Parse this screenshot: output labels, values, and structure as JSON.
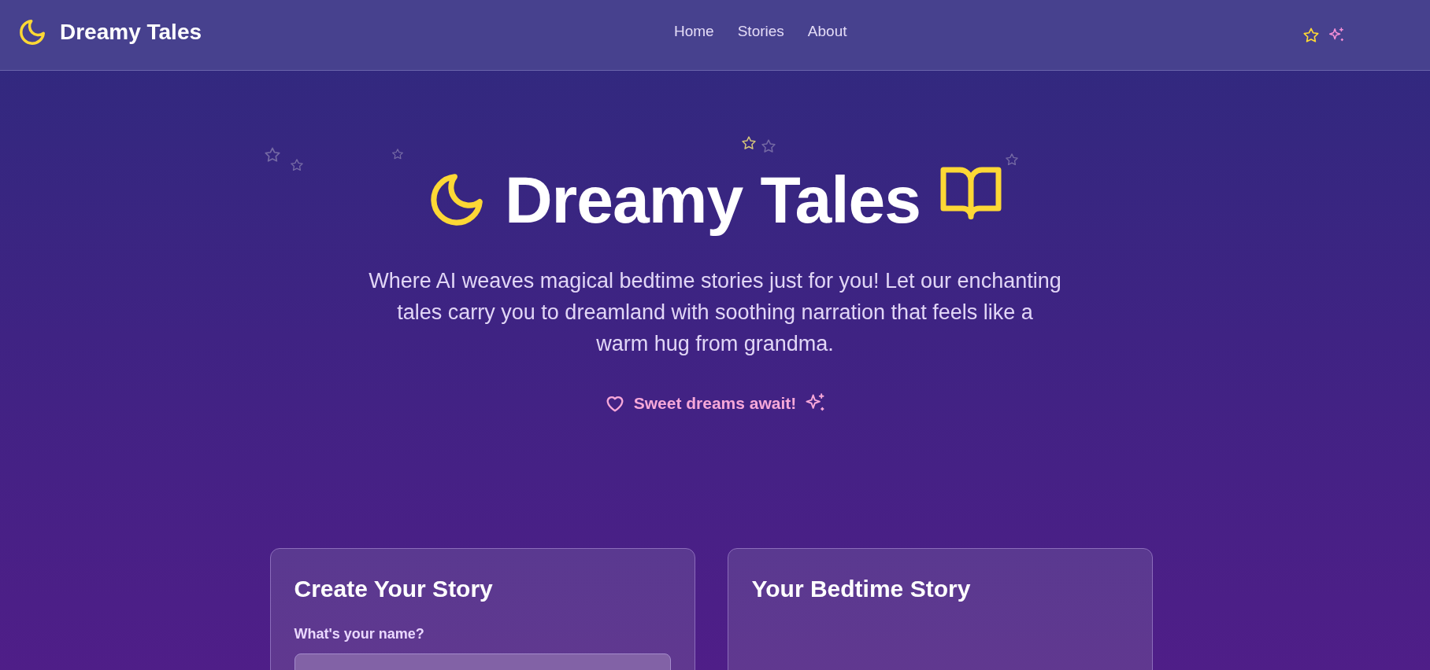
{
  "header": {
    "brand": "Dreamy Tales",
    "nav": [
      {
        "label": "Home"
      },
      {
        "label": "Stories"
      },
      {
        "label": "About"
      }
    ]
  },
  "hero": {
    "title": "Dreamy Tales",
    "subtitle": "Where AI weaves magical bedtime stories just for you! Let our enchanting tales carry you to dreamland with soothing narration that feels like a warm hug from grandma.",
    "tagline": "Sweet dreams await!"
  },
  "create_card": {
    "title": "Create Your Story",
    "fields": [
      {
        "label": "What's your name?"
      }
    ]
  },
  "story_card": {
    "title": "Your Bedtime Story"
  }
}
